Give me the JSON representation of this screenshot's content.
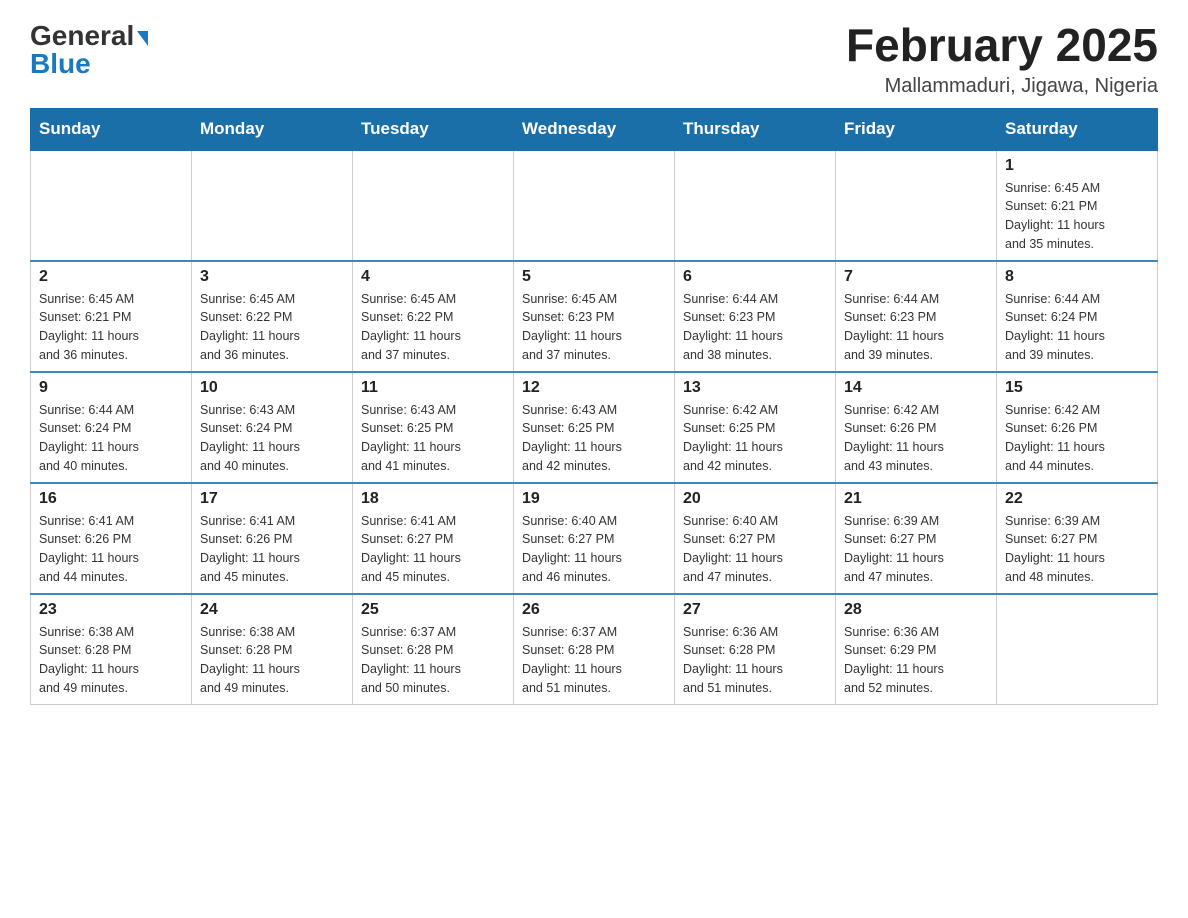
{
  "header": {
    "logo": {
      "general": "General",
      "blue": "Blue",
      "triangle": "▶"
    },
    "title": "February 2025",
    "location": "Mallammaduri, Jigawa, Nigeria"
  },
  "days_of_week": [
    "Sunday",
    "Monday",
    "Tuesday",
    "Wednesday",
    "Thursday",
    "Friday",
    "Saturday"
  ],
  "weeks": [
    [
      {
        "day": "",
        "info": ""
      },
      {
        "day": "",
        "info": ""
      },
      {
        "day": "",
        "info": ""
      },
      {
        "day": "",
        "info": ""
      },
      {
        "day": "",
        "info": ""
      },
      {
        "day": "",
        "info": ""
      },
      {
        "day": "1",
        "info": "Sunrise: 6:45 AM\nSunset: 6:21 PM\nDaylight: 11 hours\nand 35 minutes."
      }
    ],
    [
      {
        "day": "2",
        "info": "Sunrise: 6:45 AM\nSunset: 6:21 PM\nDaylight: 11 hours\nand 36 minutes."
      },
      {
        "day": "3",
        "info": "Sunrise: 6:45 AM\nSunset: 6:22 PM\nDaylight: 11 hours\nand 36 minutes."
      },
      {
        "day": "4",
        "info": "Sunrise: 6:45 AM\nSunset: 6:22 PM\nDaylight: 11 hours\nand 37 minutes."
      },
      {
        "day": "5",
        "info": "Sunrise: 6:45 AM\nSunset: 6:23 PM\nDaylight: 11 hours\nand 37 minutes."
      },
      {
        "day": "6",
        "info": "Sunrise: 6:44 AM\nSunset: 6:23 PM\nDaylight: 11 hours\nand 38 minutes."
      },
      {
        "day": "7",
        "info": "Sunrise: 6:44 AM\nSunset: 6:23 PM\nDaylight: 11 hours\nand 39 minutes."
      },
      {
        "day": "8",
        "info": "Sunrise: 6:44 AM\nSunset: 6:24 PM\nDaylight: 11 hours\nand 39 minutes."
      }
    ],
    [
      {
        "day": "9",
        "info": "Sunrise: 6:44 AM\nSunset: 6:24 PM\nDaylight: 11 hours\nand 40 minutes."
      },
      {
        "day": "10",
        "info": "Sunrise: 6:43 AM\nSunset: 6:24 PM\nDaylight: 11 hours\nand 40 minutes."
      },
      {
        "day": "11",
        "info": "Sunrise: 6:43 AM\nSunset: 6:25 PM\nDaylight: 11 hours\nand 41 minutes."
      },
      {
        "day": "12",
        "info": "Sunrise: 6:43 AM\nSunset: 6:25 PM\nDaylight: 11 hours\nand 42 minutes."
      },
      {
        "day": "13",
        "info": "Sunrise: 6:42 AM\nSunset: 6:25 PM\nDaylight: 11 hours\nand 42 minutes."
      },
      {
        "day": "14",
        "info": "Sunrise: 6:42 AM\nSunset: 6:26 PM\nDaylight: 11 hours\nand 43 minutes."
      },
      {
        "day": "15",
        "info": "Sunrise: 6:42 AM\nSunset: 6:26 PM\nDaylight: 11 hours\nand 44 minutes."
      }
    ],
    [
      {
        "day": "16",
        "info": "Sunrise: 6:41 AM\nSunset: 6:26 PM\nDaylight: 11 hours\nand 44 minutes."
      },
      {
        "day": "17",
        "info": "Sunrise: 6:41 AM\nSunset: 6:26 PM\nDaylight: 11 hours\nand 45 minutes."
      },
      {
        "day": "18",
        "info": "Sunrise: 6:41 AM\nSunset: 6:27 PM\nDaylight: 11 hours\nand 45 minutes."
      },
      {
        "day": "19",
        "info": "Sunrise: 6:40 AM\nSunset: 6:27 PM\nDaylight: 11 hours\nand 46 minutes."
      },
      {
        "day": "20",
        "info": "Sunrise: 6:40 AM\nSunset: 6:27 PM\nDaylight: 11 hours\nand 47 minutes."
      },
      {
        "day": "21",
        "info": "Sunrise: 6:39 AM\nSunset: 6:27 PM\nDaylight: 11 hours\nand 47 minutes."
      },
      {
        "day": "22",
        "info": "Sunrise: 6:39 AM\nSunset: 6:27 PM\nDaylight: 11 hours\nand 48 minutes."
      }
    ],
    [
      {
        "day": "23",
        "info": "Sunrise: 6:38 AM\nSunset: 6:28 PM\nDaylight: 11 hours\nand 49 minutes."
      },
      {
        "day": "24",
        "info": "Sunrise: 6:38 AM\nSunset: 6:28 PM\nDaylight: 11 hours\nand 49 minutes."
      },
      {
        "day": "25",
        "info": "Sunrise: 6:37 AM\nSunset: 6:28 PM\nDaylight: 11 hours\nand 50 minutes."
      },
      {
        "day": "26",
        "info": "Sunrise: 6:37 AM\nSunset: 6:28 PM\nDaylight: 11 hours\nand 51 minutes."
      },
      {
        "day": "27",
        "info": "Sunrise: 6:36 AM\nSunset: 6:28 PM\nDaylight: 11 hours\nand 51 minutes."
      },
      {
        "day": "28",
        "info": "Sunrise: 6:36 AM\nSunset: 6:29 PM\nDaylight: 11 hours\nand 52 minutes."
      },
      {
        "day": "",
        "info": ""
      }
    ]
  ]
}
